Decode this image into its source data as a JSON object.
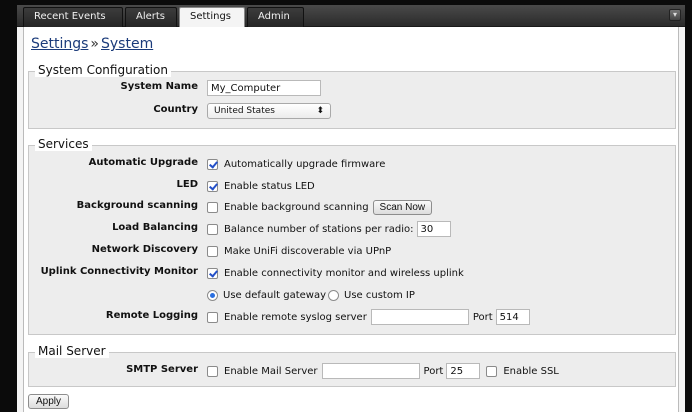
{
  "tabs": [
    {
      "label": "Recent Events"
    },
    {
      "label": "Alerts"
    },
    {
      "label": "Settings"
    },
    {
      "label": "Admin"
    }
  ],
  "breadcrumb": {
    "root": "Settings",
    "separator": "»",
    "current": "System"
  },
  "system_config": {
    "title": "System Configuration",
    "system_name_label": "System Name",
    "system_name_value": "My_Computer",
    "country_label": "Country",
    "country_value": "United States",
    "country_arrow": "⬍"
  },
  "services": {
    "title": "Services",
    "auto_upgrade": {
      "label": "Automatic Upgrade",
      "text": "Automatically upgrade firmware",
      "checked": true
    },
    "led": {
      "label": "LED",
      "text": "Enable status LED",
      "checked": true
    },
    "bg_scan": {
      "label": "Background scanning",
      "text": "Enable background scanning",
      "button": "Scan Now",
      "checked": false
    },
    "load_balancing": {
      "label": "Load Balancing",
      "text": "Balance number of stations per radio:",
      "value": "30",
      "checked": false
    },
    "network_discovery": {
      "label": "Network Discovery",
      "text": "Make UniFi discoverable via UPnP",
      "checked": false
    },
    "uplink": {
      "label": "Uplink Connectivity Monitor",
      "text": "Enable connectivity monitor and wireless uplink",
      "checked": true,
      "option_default": "Use default gateway",
      "option_custom": "Use custom IP",
      "selected": "default"
    },
    "remote_logging": {
      "label": "Remote Logging",
      "text": "Enable remote syslog server",
      "server_value": "",
      "port_label": "Port",
      "port_value": "514",
      "checked": false
    }
  },
  "mail": {
    "title": "Mail Server",
    "smtp_label": "SMTP Server",
    "enable_text": "Enable Mail Server",
    "server_value": "",
    "port_label": "Port",
    "port_value": "25",
    "ssl_text": "Enable SSL"
  },
  "apply_label": "Apply",
  "window_button": "▾"
}
